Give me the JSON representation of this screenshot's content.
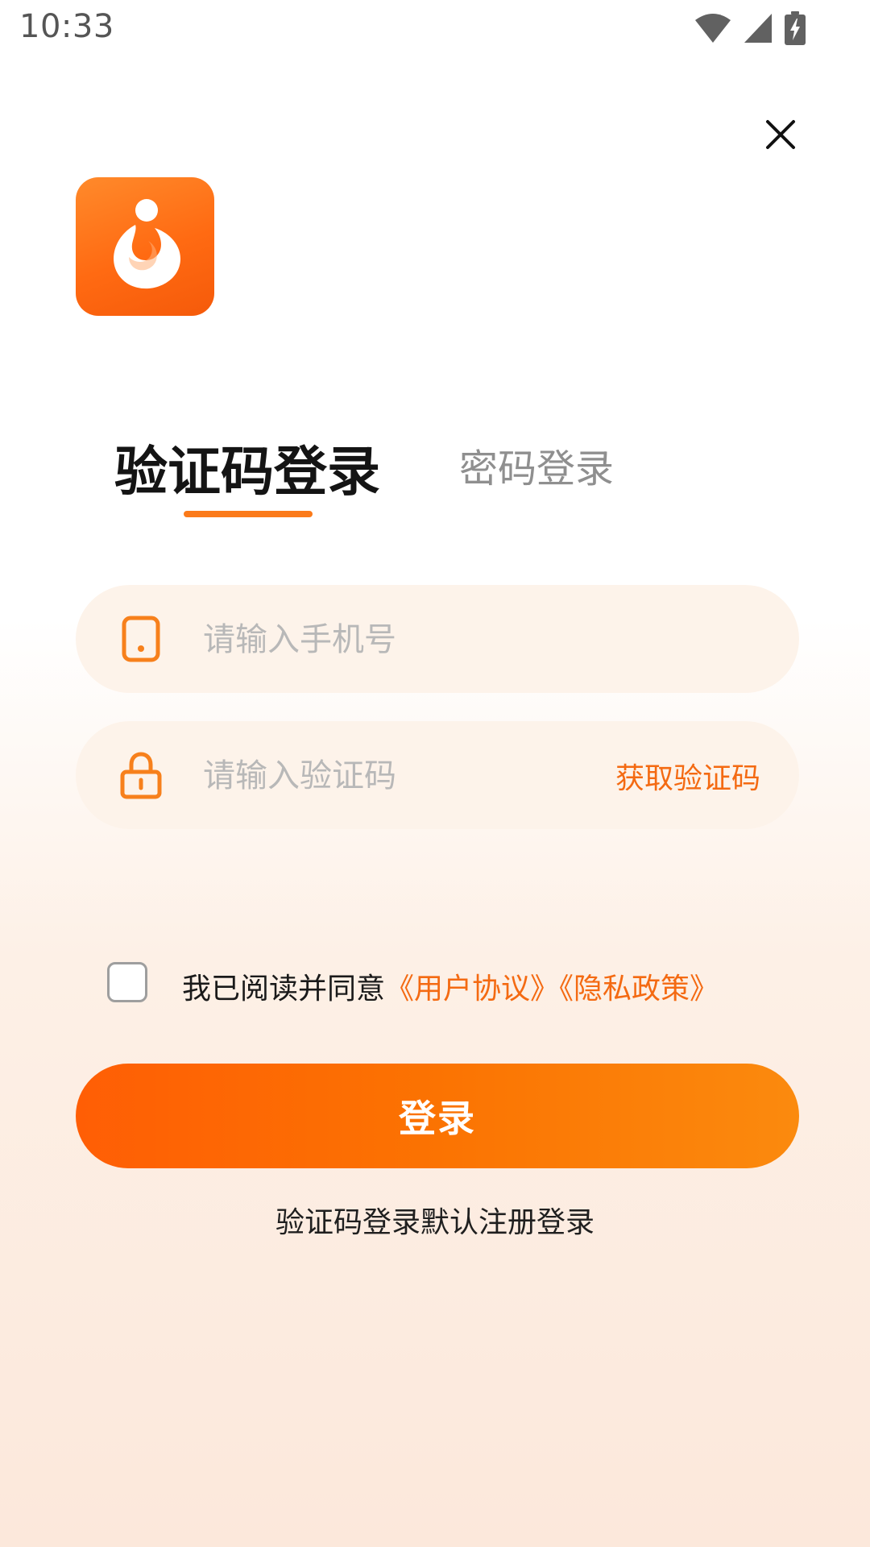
{
  "status_bar": {
    "time": "10:33",
    "icons": [
      "wifi-icon",
      "signal-icon",
      "battery-charging-icon"
    ]
  },
  "header": {
    "close_icon": "close-icon"
  },
  "logo": {
    "icon": "app-logo-icon",
    "colors": {
      "primary": "#ff6a12",
      "secondary": "#ff8a2b"
    }
  },
  "tabs": [
    {
      "label": "验证码登录",
      "active": true
    },
    {
      "label": "密码登录",
      "active": false
    }
  ],
  "form": {
    "phone": {
      "icon": "phone-icon",
      "placeholder": "请输入手机号",
      "value": ""
    },
    "code": {
      "icon": "lock-icon",
      "placeholder": "请输入验证码",
      "value": "",
      "action_label": "获取验证码"
    }
  },
  "agreement": {
    "checked": false,
    "prefix": "我已阅读并同意",
    "user_agreement": "《用户协议》",
    "privacy_policy": "《隐私政策》"
  },
  "login_button": {
    "label": "登录"
  },
  "login_note": "验证码登录默认注册登录",
  "accent_color": "#f46a12"
}
